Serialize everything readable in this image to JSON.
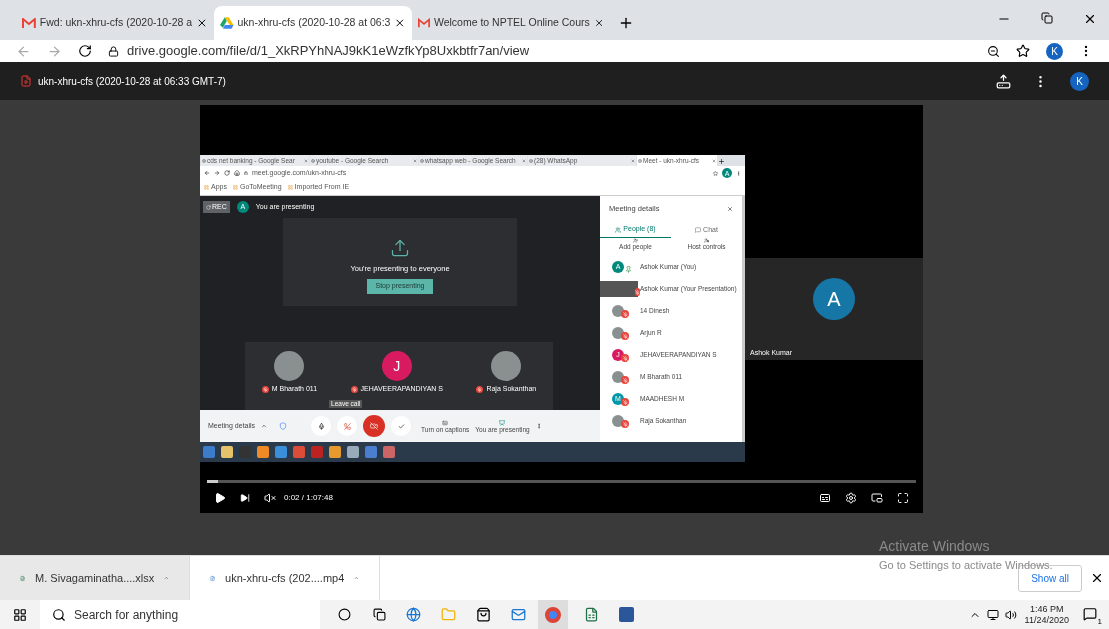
{
  "browser": {
    "tabs": [
      {
        "kind": "gmail",
        "title": "Fwd: ukn-xhru-cfs (2020-10-28 a",
        "selected": false
      },
      {
        "kind": "drive",
        "title": "ukn-xhru-cfs (2020-10-28 at 06:3",
        "selected": true
      },
      {
        "kind": "gmail",
        "title": "Welcome to NPTEL Online Cours",
        "selected": false
      }
    ],
    "url": "drive.google.com/file/d/1_XkRPYhNAJ9kK1eWzfkYp8Uxkbtfr7an/view",
    "profile": "K"
  },
  "drive_bar": {
    "title": "ukn-xhru-cfs (2020-10-28 at 06:33 GMT-7)",
    "profile": "K"
  },
  "recording": {
    "tabs": [
      {
        "title": "cds net banking - Google Sear",
        "selected": false
      },
      {
        "title": "youtube - Google Search",
        "selected": false
      },
      {
        "title": "whatsapp web - Google Search",
        "selected": false
      },
      {
        "title": "(28) WhatsApp",
        "selected": false
      },
      {
        "title": "Meet - ukn-xhru-cfs",
        "selected": true
      }
    ],
    "url": "meet.google.com/ukn-xhru-cfs",
    "profile": "A",
    "bookmarks": [
      "Apps",
      "GoToMeeting",
      "Imported From IE"
    ],
    "rec": "REC",
    "self_letter": "A",
    "status": "You are presenting",
    "card_text": "You're presenting to everyone",
    "stop_button": "Stop presenting",
    "tiles": [
      {
        "kind": "photo",
        "name": "M Bharath 011"
      },
      {
        "kind": "letter",
        "letter": "J",
        "color": "#d81b60",
        "name": "JEHAVEERAPANDIYAN S"
      },
      {
        "kind": "photo",
        "name": "Raja Sokanthan"
      }
    ],
    "toolbar": {
      "details": "Meeting details",
      "tooltip": "Leave call",
      "captions": "Turn on captions",
      "presenting": "You are presenting"
    },
    "panel": {
      "title": "Meeting details",
      "tabs": [
        {
          "label": "People (8)",
          "selected": true
        },
        {
          "label": "Chat",
          "selected": false
        }
      ],
      "actions": [
        "Add people",
        "Host controls"
      ],
      "people": [
        {
          "kind": "letter",
          "letter": "A",
          "color": "#00897b",
          "name": "Ashok Kumar (You)",
          "muted": false
        },
        {
          "kind": "screen",
          "name": "Ashok Kumar (Your Presentation)",
          "muted": true
        },
        {
          "kind": "photo",
          "name": "14 Dinesh",
          "muted": true
        },
        {
          "kind": "photo",
          "name": "Arjun R",
          "muted": true
        },
        {
          "kind": "letter",
          "letter": "J",
          "color": "#d81b60",
          "name": "JEHAVEERAPANDIYAN S",
          "muted": true
        },
        {
          "kind": "photo",
          "name": "M Bharath 011",
          "muted": true
        },
        {
          "kind": "letter",
          "letter": "M",
          "color": "#0097a7",
          "name": "MAADHESH M",
          "muted": true
        },
        {
          "kind": "photo",
          "name": "Raja Sokanthan",
          "muted": true
        }
      ]
    }
  },
  "side_tile": {
    "letter": "A",
    "name": "Ashok Kumar"
  },
  "player": {
    "level": 0.015,
    "time": "0:02 / 1:07:48"
  },
  "downloads": {
    "items": [
      {
        "kind": "xlsx",
        "name": "M. Sivagaminatha....xlsx"
      },
      {
        "kind": "video",
        "name": "ukn-xhru-cfs (202....mp4"
      }
    ],
    "show_all": "Show all"
  },
  "activation": {
    "title": "Activate Windows",
    "subtitle": "Go to Settings to activate Windows."
  },
  "taskbar": {
    "search_placeholder": "Search for anything",
    "time": "1:46 PM",
    "date": "11/24/2020",
    "notifications": "1"
  }
}
